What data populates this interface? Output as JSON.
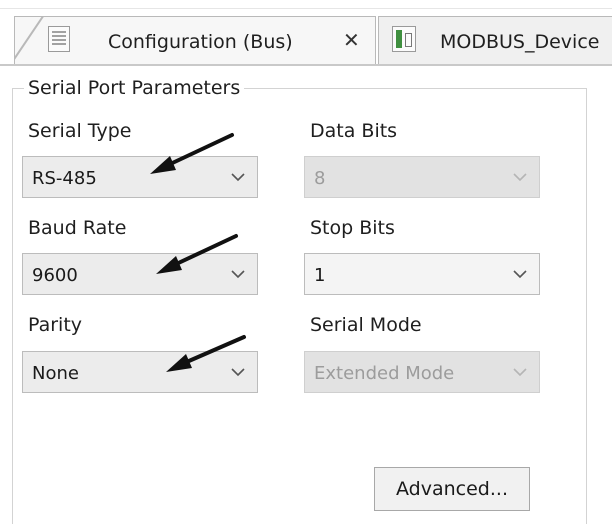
{
  "tabs": [
    {
      "label": "Configuration (Bus)",
      "icon": "document-grid-icon",
      "active": true
    },
    {
      "label": "MODBUS_Device",
      "icon": "device-icon",
      "active": false
    }
  ],
  "group": {
    "title": "Serial Port Parameters"
  },
  "fields": {
    "serial_type": {
      "label": "Serial Type",
      "value": "RS-485",
      "enabled": true
    },
    "data_bits": {
      "label": "Data Bits",
      "value": "8",
      "enabled": false
    },
    "baud_rate": {
      "label": "Baud Rate",
      "value": "9600",
      "enabled": true
    },
    "stop_bits": {
      "label": "Stop Bits",
      "value": "1",
      "enabled": true
    },
    "parity": {
      "label": "Parity",
      "value": "None",
      "enabled": true
    },
    "serial_mode": {
      "label": "Serial Mode",
      "value": "Extended Mode",
      "enabled": false
    }
  },
  "buttons": {
    "advanced": "Advanced..."
  },
  "colors": {
    "arrow": "#111111",
    "disabled_text": "#9c9c9c"
  }
}
